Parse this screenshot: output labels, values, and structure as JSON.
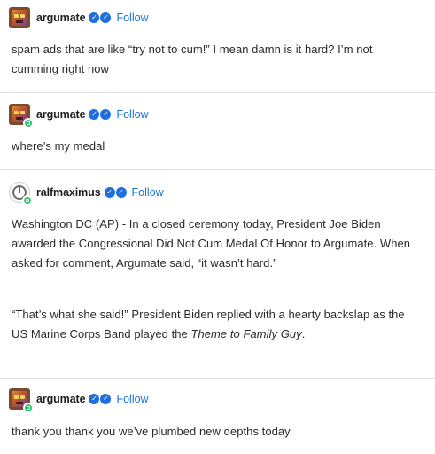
{
  "posts": [
    {
      "username": "argumate",
      "follow_label": "Follow",
      "paragraphs": [
        "spam ads that are like “try not to cum!” I mean damn is it hard? I’m not cumming right now"
      ]
    },
    {
      "username": "argumate",
      "follow_label": "Follow",
      "paragraphs": [
        "where’s my medal"
      ]
    },
    {
      "username": "ralfmaximus",
      "follow_label": "Follow",
      "paragraphs": [
        "Washington DC (AP) - In a closed ceremony today, President Joe Biden awarded the Congressional Did Not Cum Medal Of Honor to Argumate. When asked for comment, Argumate said, “it wasn’t hard.”",
        "“That’s what she said!” President Biden replied with a hearty backslap as the US Marine Corps Band played the",
        "Theme to Family Guy",
        "."
      ]
    },
    {
      "username": "argumate",
      "follow_label": "Follow",
      "paragraphs": [
        "thank you thank you we’ve plumbed new depths today"
      ]
    }
  ],
  "icons": {
    "verified_badge": "checkmark-badge-icon",
    "online_badge": "online-status-icon"
  },
  "colors": {
    "follow_link": "#1a73d9",
    "verified": "#1d6fe0",
    "online": "#2cc36b",
    "divider": "#e3e3e3"
  }
}
